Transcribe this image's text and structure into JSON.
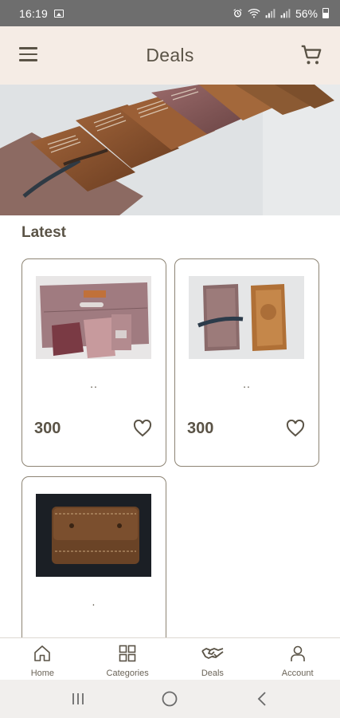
{
  "status_bar": {
    "time": "16:19",
    "battery": "56%",
    "icons": [
      "gallery-icon",
      "alarm-icon",
      "wifi-icon",
      "signal-icon",
      "signal-icon",
      "battery-icon"
    ]
  },
  "app_bar": {
    "title": "Deals",
    "menu_icon": "hamburger-menu-icon",
    "cart_icon": "shopping-cart-icon"
  },
  "section": {
    "title": "Latest"
  },
  "products": [
    {
      "name": "..",
      "price": "300",
      "image": "pink leather wallet with strap",
      "favorite_icon": "heart-outline-icon"
    },
    {
      "name": "..",
      "price": "300",
      "image": "two leather journals",
      "favorite_icon": "heart-outline-icon"
    },
    {
      "name": ".",
      "price": "",
      "image": "brown leather wallet on dark background",
      "favorite_icon": ""
    }
  ],
  "bottom_nav": {
    "items": [
      {
        "label": "Home",
        "icon": "home-icon"
      },
      {
        "label": "Categories",
        "icon": "grid-icon"
      },
      {
        "label": "Deals",
        "icon": "handshake-icon",
        "active": true
      },
      {
        "label": "Account",
        "icon": "person-icon"
      }
    ]
  },
  "colors": {
    "app_bar_bg": "#f5ece5",
    "text_primary": "#5a5346",
    "card_border": "#8d8474",
    "status_bar_bg": "#6e6e6e"
  }
}
